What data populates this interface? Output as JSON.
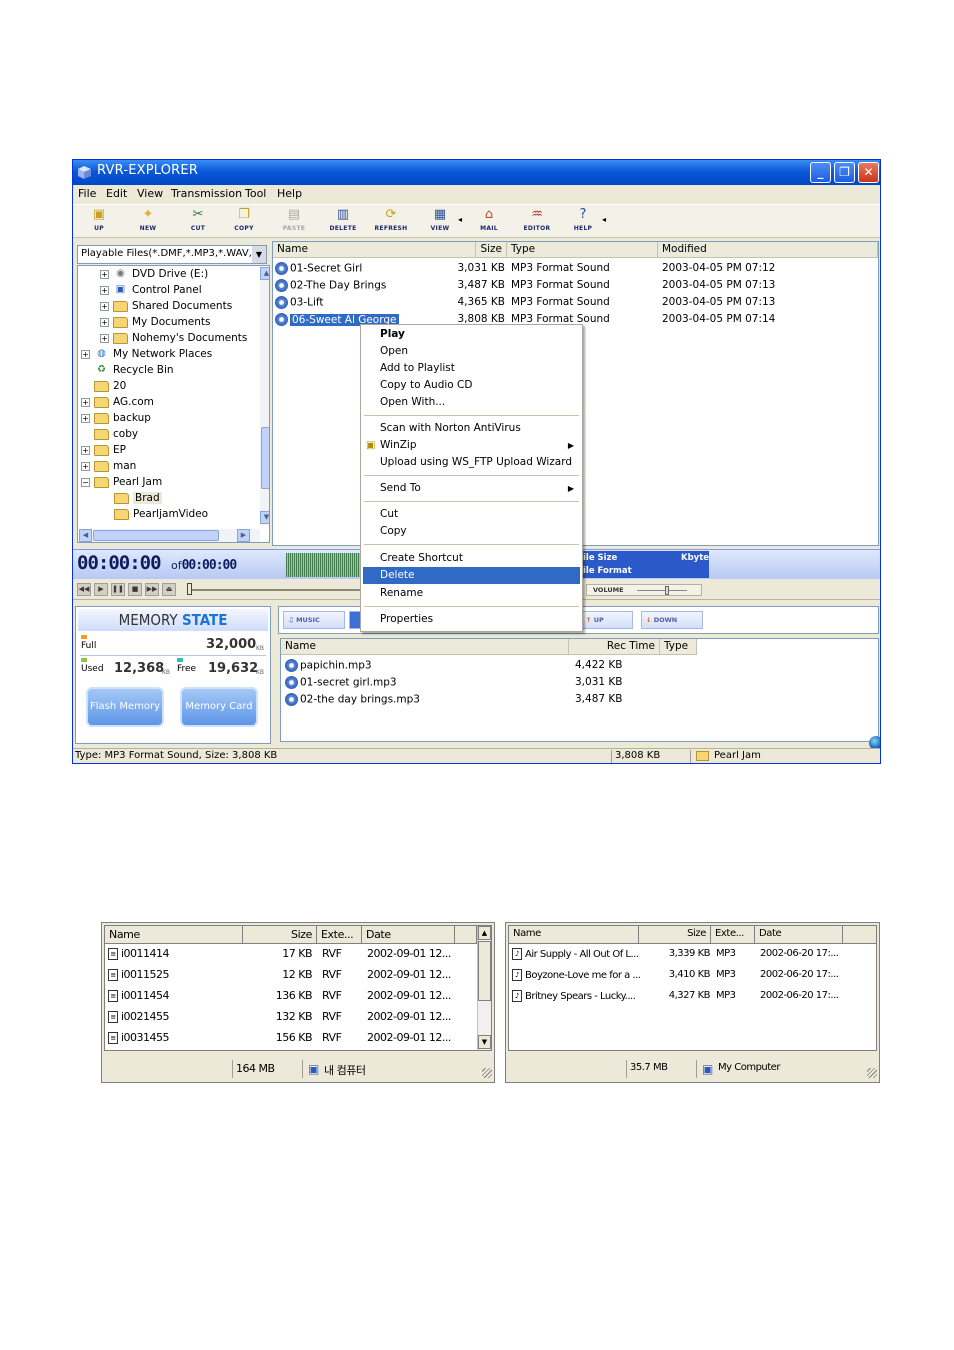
{
  "window": {
    "title": "RVR-EXPLORER",
    "controls": {
      "minimize": "_",
      "restore": "❐",
      "close": "✕"
    }
  },
  "menu": [
    "File",
    "Edit",
    "View",
    "Transmission",
    "Tool",
    "Help"
  ],
  "toolbar": {
    "up": "UP",
    "new": "NEW",
    "cut": "CUT",
    "copy": "COPY",
    "paste": "PASTE",
    "delete": "DELETE",
    "refresh": "REFRESH",
    "view": "VIEW",
    "mail": "MAIL",
    "editor": "EDITOR",
    "help": "HELP"
  },
  "filter": "Playable Files(*.DMF,*.MP3,*.WAV,",
  "tree": [
    {
      "label": "DVD Drive (E:)",
      "icon": "dvd-drive-icon"
    },
    {
      "label": "Control Panel",
      "icon": "control-panel-icon"
    },
    {
      "label": "Shared Documents",
      "icon": "folder-icon"
    },
    {
      "label": "My Documents",
      "icon": "folder-icon"
    },
    {
      "label": "Nohemy's Documents",
      "icon": "folder-icon"
    },
    {
      "label": "My Network Places",
      "icon": "network-icon"
    },
    {
      "label": "Recycle Bin",
      "icon": "recycle-bin-icon"
    },
    {
      "label": "20",
      "icon": "folder-icon"
    },
    {
      "label": "AG.com",
      "icon": "folder-icon"
    },
    {
      "label": "backup",
      "icon": "folder-icon"
    },
    {
      "label": "coby",
      "icon": "folder-icon"
    },
    {
      "label": "EP",
      "icon": "folder-icon"
    },
    {
      "label": "man",
      "icon": "folder-icon"
    },
    {
      "label": "Pearl Jam",
      "icon": "folder-icon"
    },
    {
      "label": "Brad",
      "icon": "folder-icon"
    },
    {
      "label": "PearljamVideo",
      "icon": "folder-icon"
    }
  ],
  "filelist": {
    "headers": {
      "name": "Name",
      "size": "Size",
      "type": "Type",
      "modified": "Modified"
    },
    "rows": [
      {
        "name": "01-Secret Girl",
        "size": "3,031 KB",
        "type": "MP3 Format Sound",
        "modified": "2003-04-05 PM 07:12"
      },
      {
        "name": "02-The Day Brings",
        "size": "3,487 KB",
        "type": "MP3 Format Sound",
        "modified": "2003-04-05 PM 07:13"
      },
      {
        "name": "03-Lift",
        "size": "4,365 KB",
        "type": "MP3 Format Sound",
        "modified": "2003-04-05 PM 07:13"
      },
      {
        "name": "06-Sweet Al George",
        "size": "3,808 KB",
        "type": "MP3 Format Sound",
        "modified": "2003-04-05 PM 07:14"
      }
    ]
  },
  "context_menu": {
    "play": "Play",
    "open": "Open",
    "add_playlist": "Add to Playlist",
    "copy_cd": "Copy to Audio CD",
    "open_with": "Open With...",
    "norton": "Scan with Norton AntiVirus",
    "winzip": "WinZip",
    "wsftp": "Upload using WS_FTP Upload Wizard",
    "send_to": "Send To",
    "cut": "Cut",
    "copy": "Copy",
    "shortcut": "Create Shortcut",
    "delete": "Delete",
    "rename": "Rename",
    "properties": "Properties"
  },
  "player": {
    "elapsed": "00:00:00",
    "of": "of",
    "total": "00:00:00",
    "file_size_label": "ile Size",
    "file_size_unit": "Kbyte",
    "file_format_label": "ile Format",
    "volume_label": "VOLUME"
  },
  "memory": {
    "title_a": "MEMORY",
    "title_b": "STATE",
    "full_label": "Full",
    "full_value": "32,000",
    "kb": "KB",
    "used_label": "Used",
    "used_value": "12,368",
    "free_label": "Free",
    "free_value": "19,632",
    "flash_button": "Flash Memory",
    "card_button": "Memory Card"
  },
  "lower_tabs": {
    "music": "MUSIC",
    "up": "UP",
    "down": "DOWN"
  },
  "device_list": {
    "headers": {
      "name": "Name",
      "rec": "Rec Time",
      "type": "Type"
    },
    "rows": [
      {
        "name": "papichin.mp3",
        "rec": "4,422 KB"
      },
      {
        "name": "01-secret girl.mp3",
        "rec": "3,031 KB"
      },
      {
        "name": "02-the day brings.mp3",
        "rec": "3,487 KB"
      }
    ]
  },
  "statusbar": {
    "info": "Type: MP3 Format Sound, Size: 3,808 KB",
    "size": "3,808 KB",
    "folder": "Pearl Jam"
  },
  "panel_left": {
    "headers": {
      "name": "Name",
      "size": "Size",
      "ext": "Exte...",
      "date": "Date"
    },
    "rows": [
      {
        "name": "i0011414",
        "size": "17 KB",
        "ext": "RVF",
        "date": "2002-09-01 12..."
      },
      {
        "name": "i0011525",
        "size": "12 KB",
        "ext": "RVF",
        "date": "2002-09-01 12..."
      },
      {
        "name": "i0011454",
        "size": "136 KB",
        "ext": "RVF",
        "date": "2002-09-01 12..."
      },
      {
        "name": "i0021455",
        "size": "132 KB",
        "ext": "RVF",
        "date": "2002-09-01 12..."
      },
      {
        "name": "i0031455",
        "size": "156 KB",
        "ext": "RVF",
        "date": "2002-09-01 12..."
      }
    ],
    "status_size": "164 MB",
    "status_location": "내 컴퓨터"
  },
  "panel_right": {
    "headers": {
      "name": "Name",
      "size": "Size",
      "ext": "Exte...",
      "date": "Date"
    },
    "rows": [
      {
        "name": "Air Supply - All Out Of L...",
        "size": "3,339 KB",
        "ext": "MP3",
        "date": "2002-06-20 17:..."
      },
      {
        "name": "Boyzone-Love me for a ...",
        "size": "3,410 KB",
        "ext": "MP3",
        "date": "2002-06-20 17:..."
      },
      {
        "name": "Britney Spears - Lucky....",
        "size": "4,327 KB",
        "ext": "MP3",
        "date": "2002-06-20 17:..."
      }
    ],
    "status_size": "35.7 MB",
    "status_location": "My Computer"
  }
}
